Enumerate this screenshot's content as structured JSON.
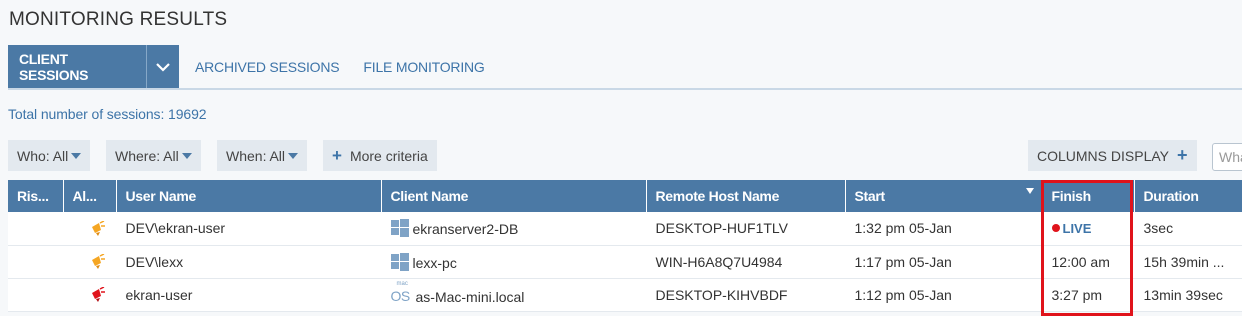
{
  "page": {
    "title": "MONITORING RESULTS"
  },
  "tabs": {
    "active": "CLIENT SESSIONS",
    "archived": "ARCHIVED SESSIONS",
    "file_monitoring": "FILE MONITORING"
  },
  "total_sessions": "Total number of sessions: 19692",
  "filters": {
    "who": {
      "label": "Who:",
      "value": "All"
    },
    "where": {
      "label": "Where:",
      "value": "All"
    },
    "when": {
      "label": "When:",
      "value": "All"
    },
    "more_criteria": "More criteria"
  },
  "columns_display": "COLUMNS DISPLAY",
  "search": {
    "placeholder": "What"
  },
  "table": {
    "headers": [
      "Ris...",
      "Al...",
      "User Name",
      "Client Name",
      "Remote Host Name",
      "Start",
      "Finish",
      "Duration"
    ],
    "rows": [
      {
        "alert": "orange",
        "user": "DEV\\ekran-user",
        "client": "ekranserver2-DB",
        "client_os": "windows",
        "remote_host": "DESKTOP-HUF1TLV",
        "start": "1:32 pm 05-Jan",
        "finish": "LIVE",
        "duration": "3sec"
      },
      {
        "alert": "orange",
        "user": "DEV\\lexx",
        "client": "lexx-pc",
        "client_os": "windows",
        "remote_host": "WIN-H6A8Q7U4984",
        "start": "1:17 pm 05-Jan",
        "finish": "12:00 am",
        "duration": "15h 39min ..."
      },
      {
        "alert": "red",
        "user": "ekran-user",
        "client": "as-Mac-mini.local",
        "client_os": "mac",
        "remote_host": "DESKTOP-KIHVBDF",
        "start": "1:12 pm 05-Jan",
        "finish": "3:27 pm",
        "duration": "13min 39sec"
      }
    ]
  },
  "mac_icon": {
    "small": "mac",
    "big": "OS"
  },
  "colors": {
    "accent": "#4b79a5",
    "link": "#3d74a8",
    "live": "#e0131b",
    "alert_orange": "#f5a623",
    "alert_red": "#e0131b"
  },
  "icons": {
    "tab_dropdown": "chevron-down-icon",
    "windows": "windows-icon",
    "mac": "mac-os-icon",
    "alert": "alert-bell-icon",
    "live": "live-dot-icon",
    "plus": "plus-icon",
    "sort": "sort-desc-icon"
  }
}
